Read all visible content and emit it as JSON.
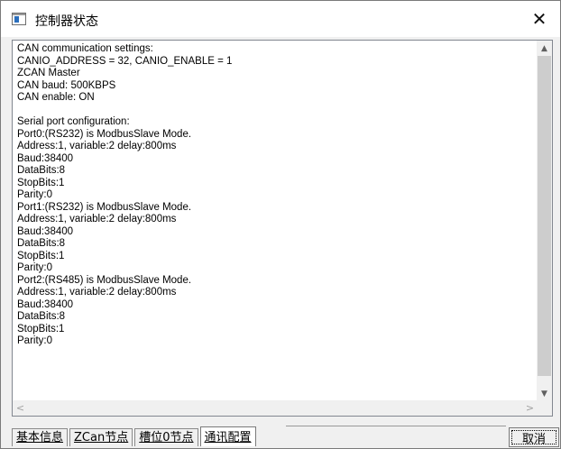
{
  "window": {
    "title": "控制器状态",
    "close_glyph": "✕"
  },
  "status_text": "CAN communication settings:\nCANIO_ADDRESS = 32, CANIO_ENABLE = 1\nZCAN Master\nCAN baud: 500KBPS\nCAN enable: ON\n\nSerial port configuration:\nPort0:(RS232) is ModbusSlave Mode.\nAddress:1, variable:2 delay:800ms\nBaud:38400\nDataBits:8\nStopBits:1\nParity:0\nPort1:(RS232) is ModbusSlave Mode.\nAddress:1, variable:2 delay:800ms\nBaud:38400\nDataBits:8\nStopBits:1\nParity:0\nPort2:(RS485) is ModbusSlave Mode.\nAddress:1, variable:2 delay:800ms\nBaud:38400\nDataBits:8\nStopBits:1\nParity:0",
  "scrollbars": {
    "up_arrow": "▲",
    "down_arrow": "▼",
    "left_arrow": "<",
    "right_arrow": ">"
  },
  "tabs": [
    {
      "label": "基本信息",
      "active": false
    },
    {
      "label": "ZCan节点",
      "active": false
    },
    {
      "label": "槽位0节点",
      "active": false
    },
    {
      "label": "通讯配置",
      "active": true
    }
  ],
  "buttons": {
    "cancel": "取消"
  },
  "icons": {
    "app": "window-icon",
    "close": "close-icon"
  }
}
